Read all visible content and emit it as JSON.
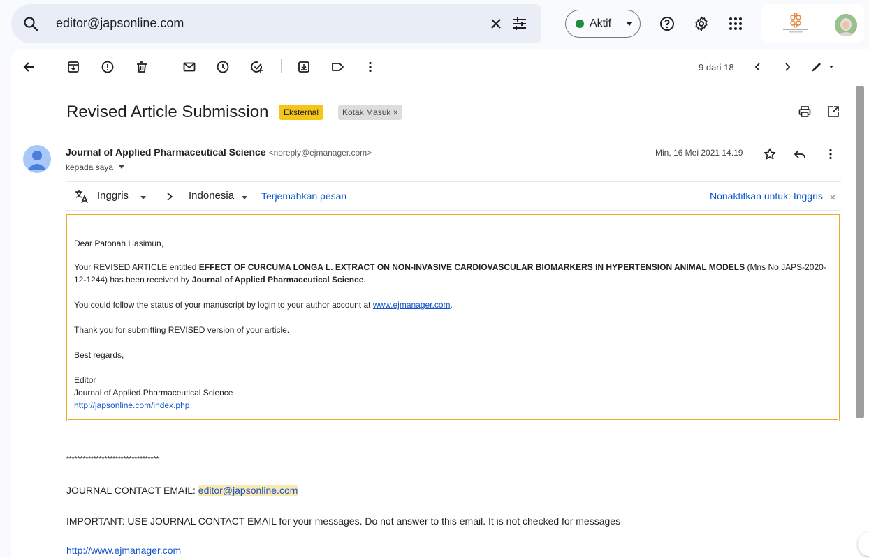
{
  "search": {
    "value": "editor@japsonline.com"
  },
  "status": {
    "label": "Aktif"
  },
  "accent_colors": {
    "label_eksternal": "#f5c518",
    "status_green": "#1e8e3e",
    "link": "#1155cc",
    "box_border": "#f5a623"
  },
  "toolbar": {
    "pager": "9 dari 18"
  },
  "subject": "Revised Article Submission",
  "labels": {
    "external": "Eksternal",
    "inbox": "Kotak Masuk",
    "remove_mark": "×"
  },
  "sender": {
    "name": "Journal of Applied Pharmaceutical Science",
    "email": "<noreply@ejmanager.com>",
    "to": "kepada saya",
    "date": "Min, 16 Mei 2021 14.19"
  },
  "translate": {
    "from": "Inggris",
    "to": "Indonesia",
    "action": "Terjemahkan pesan",
    "disable": "Nonaktifkan untuk: Inggris"
  },
  "body": {
    "greeting": "Dear Patonah Hasimun,",
    "p1_a": "Your REVISED ARTICLE entitled ",
    "p1_title": "EFFECT OF CURCUMA LONGA L. EXTRACT ON NON-INVASIVE CARDIOVASCULAR BIOMARKERS IN HYPERTENSION ANIMAL MODELS",
    "p1_b": " (Mns No:JAPS-2020-12-1244) has been received by ",
    "p1_journal": "Journal of Applied Pharmaceutical Science",
    "p1_c": ".",
    "p2_a": "You could follow the status of your manuscript by login to your author account at ",
    "p2_link": "www.ejmanager.com",
    "p2_c": ".",
    "p3": "Thank you for submitting REVISED version of your article.",
    "p4": "Best regards,",
    "sig1": "Editor",
    "sig2": "Journal of Applied Pharmaceutical Science",
    "sig3": "http://japsonline.com/index.php"
  },
  "footer": {
    "stars": "**********************************",
    "contact_label": "JOURNAL CONTACT EMAIL: ",
    "contact_email": "editor@japsonline.com",
    "important": "IMPORTANT: USE JOURNAL CONTACT EMAIL for your messages. Do not answer to this email. It is not checked for messages",
    "link": "http://www.ejmanager.com"
  }
}
